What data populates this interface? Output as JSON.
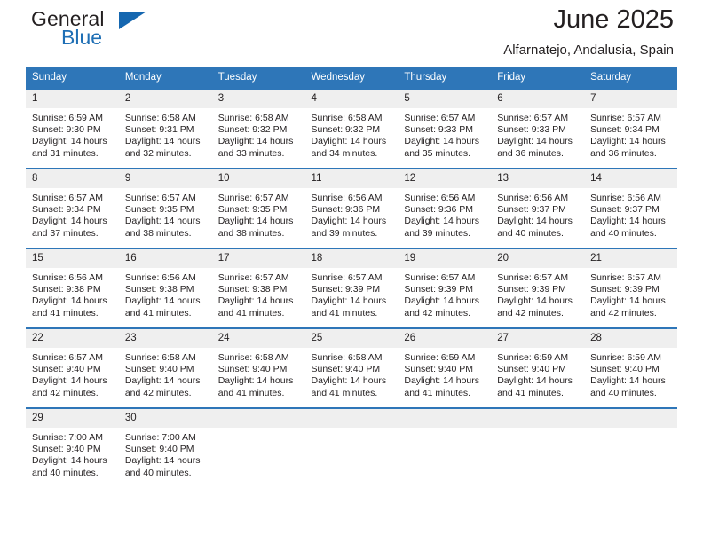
{
  "brand": {
    "name_part1": "General",
    "name_part2": "Blue",
    "triangle_color": "#1567b0",
    "blue_color": "#1f6fb5"
  },
  "header": {
    "title": "June 2025",
    "location": "Alfarnatejo, Andalusia, Spain"
  },
  "theme": {
    "header_bg": "#2e76b8",
    "daynum_bg": "#efefef",
    "text": "#231f20"
  },
  "weekday_headers": [
    "Sunday",
    "Monday",
    "Tuesday",
    "Wednesday",
    "Thursday",
    "Friday",
    "Saturday"
  ],
  "weeks": [
    [
      {
        "day": "1",
        "sunrise": "Sunrise: 6:59 AM",
        "sunset": "Sunset: 9:30 PM",
        "daylight": "Daylight: 14 hours and 31 minutes."
      },
      {
        "day": "2",
        "sunrise": "Sunrise: 6:58 AM",
        "sunset": "Sunset: 9:31 PM",
        "daylight": "Daylight: 14 hours and 32 minutes."
      },
      {
        "day": "3",
        "sunrise": "Sunrise: 6:58 AM",
        "sunset": "Sunset: 9:32 PM",
        "daylight": "Daylight: 14 hours and 33 minutes."
      },
      {
        "day": "4",
        "sunrise": "Sunrise: 6:58 AM",
        "sunset": "Sunset: 9:32 PM",
        "daylight": "Daylight: 14 hours and 34 minutes."
      },
      {
        "day": "5",
        "sunrise": "Sunrise: 6:57 AM",
        "sunset": "Sunset: 9:33 PM",
        "daylight": "Daylight: 14 hours and 35 minutes."
      },
      {
        "day": "6",
        "sunrise": "Sunrise: 6:57 AM",
        "sunset": "Sunset: 9:33 PM",
        "daylight": "Daylight: 14 hours and 36 minutes."
      },
      {
        "day": "7",
        "sunrise": "Sunrise: 6:57 AM",
        "sunset": "Sunset: 9:34 PM",
        "daylight": "Daylight: 14 hours and 36 minutes."
      }
    ],
    [
      {
        "day": "8",
        "sunrise": "Sunrise: 6:57 AM",
        "sunset": "Sunset: 9:34 PM",
        "daylight": "Daylight: 14 hours and 37 minutes."
      },
      {
        "day": "9",
        "sunrise": "Sunrise: 6:57 AM",
        "sunset": "Sunset: 9:35 PM",
        "daylight": "Daylight: 14 hours and 38 minutes."
      },
      {
        "day": "10",
        "sunrise": "Sunrise: 6:57 AM",
        "sunset": "Sunset: 9:35 PM",
        "daylight": "Daylight: 14 hours and 38 minutes."
      },
      {
        "day": "11",
        "sunrise": "Sunrise: 6:56 AM",
        "sunset": "Sunset: 9:36 PM",
        "daylight": "Daylight: 14 hours and 39 minutes."
      },
      {
        "day": "12",
        "sunrise": "Sunrise: 6:56 AM",
        "sunset": "Sunset: 9:36 PM",
        "daylight": "Daylight: 14 hours and 39 minutes."
      },
      {
        "day": "13",
        "sunrise": "Sunrise: 6:56 AM",
        "sunset": "Sunset: 9:37 PM",
        "daylight": "Daylight: 14 hours and 40 minutes."
      },
      {
        "day": "14",
        "sunrise": "Sunrise: 6:56 AM",
        "sunset": "Sunset: 9:37 PM",
        "daylight": "Daylight: 14 hours and 40 minutes."
      }
    ],
    [
      {
        "day": "15",
        "sunrise": "Sunrise: 6:56 AM",
        "sunset": "Sunset: 9:38 PM",
        "daylight": "Daylight: 14 hours and 41 minutes."
      },
      {
        "day": "16",
        "sunrise": "Sunrise: 6:56 AM",
        "sunset": "Sunset: 9:38 PM",
        "daylight": "Daylight: 14 hours and 41 minutes."
      },
      {
        "day": "17",
        "sunrise": "Sunrise: 6:57 AM",
        "sunset": "Sunset: 9:38 PM",
        "daylight": "Daylight: 14 hours and 41 minutes."
      },
      {
        "day": "18",
        "sunrise": "Sunrise: 6:57 AM",
        "sunset": "Sunset: 9:39 PM",
        "daylight": "Daylight: 14 hours and 41 minutes."
      },
      {
        "day": "19",
        "sunrise": "Sunrise: 6:57 AM",
        "sunset": "Sunset: 9:39 PM",
        "daylight": "Daylight: 14 hours and 42 minutes."
      },
      {
        "day": "20",
        "sunrise": "Sunrise: 6:57 AM",
        "sunset": "Sunset: 9:39 PM",
        "daylight": "Daylight: 14 hours and 42 minutes."
      },
      {
        "day": "21",
        "sunrise": "Sunrise: 6:57 AM",
        "sunset": "Sunset: 9:39 PM",
        "daylight": "Daylight: 14 hours and 42 minutes."
      }
    ],
    [
      {
        "day": "22",
        "sunrise": "Sunrise: 6:57 AM",
        "sunset": "Sunset: 9:40 PM",
        "daylight": "Daylight: 14 hours and 42 minutes."
      },
      {
        "day": "23",
        "sunrise": "Sunrise: 6:58 AM",
        "sunset": "Sunset: 9:40 PM",
        "daylight": "Daylight: 14 hours and 42 minutes."
      },
      {
        "day": "24",
        "sunrise": "Sunrise: 6:58 AM",
        "sunset": "Sunset: 9:40 PM",
        "daylight": "Daylight: 14 hours and 41 minutes."
      },
      {
        "day": "25",
        "sunrise": "Sunrise: 6:58 AM",
        "sunset": "Sunset: 9:40 PM",
        "daylight": "Daylight: 14 hours and 41 minutes."
      },
      {
        "day": "26",
        "sunrise": "Sunrise: 6:59 AM",
        "sunset": "Sunset: 9:40 PM",
        "daylight": "Daylight: 14 hours and 41 minutes."
      },
      {
        "day": "27",
        "sunrise": "Sunrise: 6:59 AM",
        "sunset": "Sunset: 9:40 PM",
        "daylight": "Daylight: 14 hours and 41 minutes."
      },
      {
        "day": "28",
        "sunrise": "Sunrise: 6:59 AM",
        "sunset": "Sunset: 9:40 PM",
        "daylight": "Daylight: 14 hours and 40 minutes."
      }
    ],
    [
      {
        "day": "29",
        "sunrise": "Sunrise: 7:00 AM",
        "sunset": "Sunset: 9:40 PM",
        "daylight": "Daylight: 14 hours and 40 minutes."
      },
      {
        "day": "30",
        "sunrise": "Sunrise: 7:00 AM",
        "sunset": "Sunset: 9:40 PM",
        "daylight": "Daylight: 14 hours and 40 minutes."
      },
      {
        "day": "",
        "sunrise": "",
        "sunset": "",
        "daylight": ""
      },
      {
        "day": "",
        "sunrise": "",
        "sunset": "",
        "daylight": ""
      },
      {
        "day": "",
        "sunrise": "",
        "sunset": "",
        "daylight": ""
      },
      {
        "day": "",
        "sunrise": "",
        "sunset": "",
        "daylight": ""
      },
      {
        "day": "",
        "sunrise": "",
        "sunset": "",
        "daylight": ""
      }
    ]
  ]
}
